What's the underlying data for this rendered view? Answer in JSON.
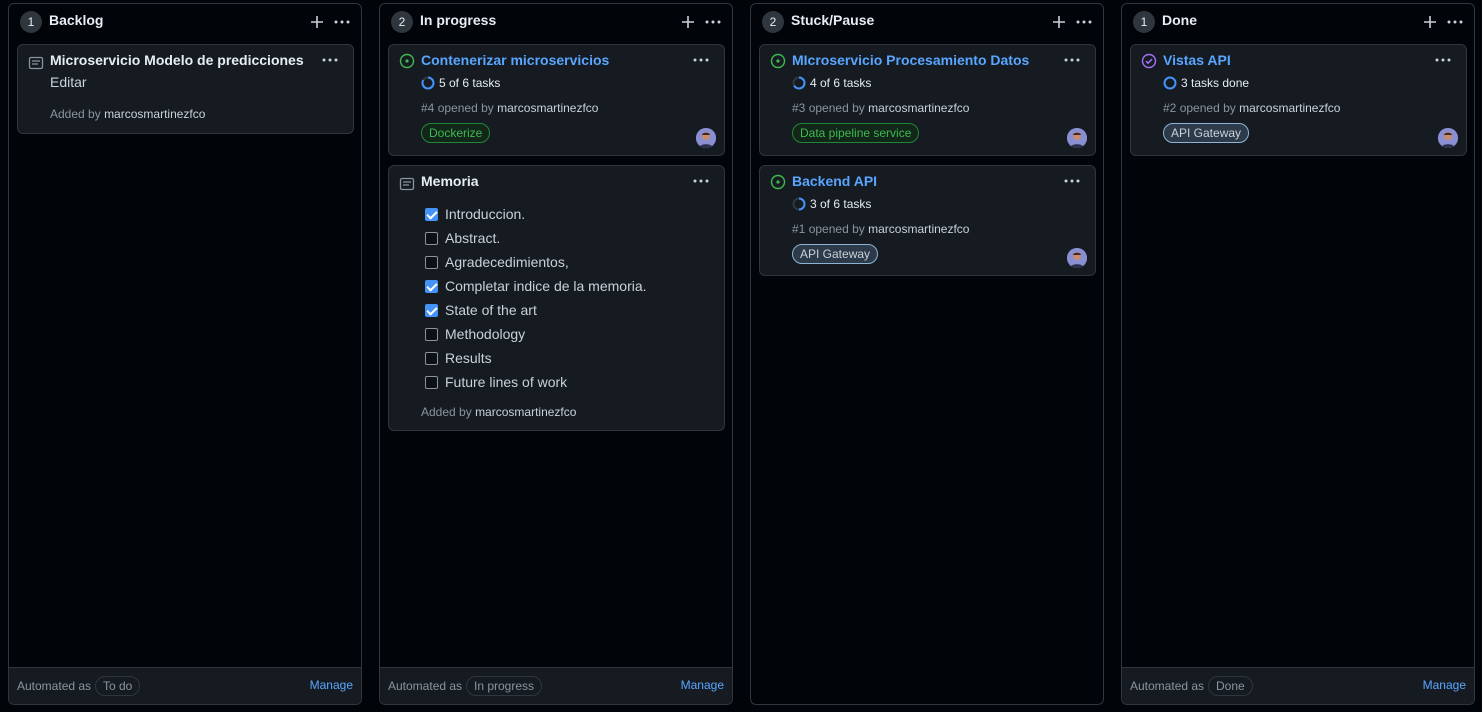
{
  "columns": [
    {
      "count": "1",
      "title": "Backlog",
      "automated_label": "Automated as",
      "automated_value": "To do",
      "manage": "Manage",
      "cards": [
        {
          "title": "Microservicio Modelo de predicciones",
          "subtitle": "Editar",
          "added_prefix": "Added by",
          "added_user": "marcosmartinezfco"
        }
      ]
    },
    {
      "count": "2",
      "title": "In progress",
      "automated_label": "Automated as",
      "automated_value": "In progress",
      "manage": "Manage",
      "cards": [
        {
          "title": "Contenerizar microservicios",
          "progress": "5 of 6 tasks",
          "progress_fraction": 0.833,
          "number": "#4",
          "opened_text": "opened by",
          "user": "marcosmartinezfco",
          "label": "Dockerize",
          "label_color": "#3fb950"
        },
        {
          "title": "Memoria",
          "checklist": [
            {
              "text": "Introduccion.",
              "checked": true
            },
            {
              "text": "Abstract.",
              "checked": false
            },
            {
              "text": "Agradecedimientos,",
              "checked": false
            },
            {
              "text": "Completar indice de la memoria.",
              "checked": true
            },
            {
              "text": "State of the art",
              "checked": true
            },
            {
              "text": "Methodology",
              "checked": false
            },
            {
              "text": "Results",
              "checked": false
            },
            {
              "text": "Future lines of work",
              "checked": false
            }
          ],
          "added_prefix": "Added by",
          "added_user": "marcosmartinezfco"
        }
      ]
    },
    {
      "count": "2",
      "title": "Stuck/Pause",
      "cards": [
        {
          "title": "MIcroservicio Procesamiento Datos",
          "progress": "4 of 6 tasks",
          "progress_fraction": 0.667,
          "number": "#3",
          "opened_text": "opened by",
          "user": "marcosmartinezfco",
          "label": "Data pipeline service",
          "label_color": "#3fb950"
        },
        {
          "title": "Backend API",
          "progress": "3 of 6 tasks",
          "progress_fraction": 0.5,
          "number": "#1",
          "opened_text": "opened by",
          "user": "marcosmartinezfco",
          "label": "API Gateway",
          "label_color": "#8db4d6"
        }
      ]
    },
    {
      "count": "1",
      "title": "Done",
      "automated_label": "Automated as",
      "automated_value": "Done",
      "manage": "Manage",
      "cards": [
        {
          "title": "Vistas API",
          "progress": "3 tasks done",
          "progress_fraction": 1,
          "number": "#2",
          "opened_text": "opened by",
          "user": "marcosmartinezfco",
          "label": "API Gateway",
          "label_color": "#8db4d6",
          "state": "closed"
        }
      ]
    }
  ],
  "colors": {
    "background": "#010409",
    "card": "#161b22",
    "border": "#30363d",
    "link": "#58a6ff",
    "open_state": "#3fb950",
    "closed_state": "#a371f7"
  },
  "icons": [
    "plus-icon",
    "kebab-icon",
    "note-icon",
    "issue-open-icon",
    "issue-closed-icon",
    "progress-ring-icon",
    "avatar"
  ]
}
